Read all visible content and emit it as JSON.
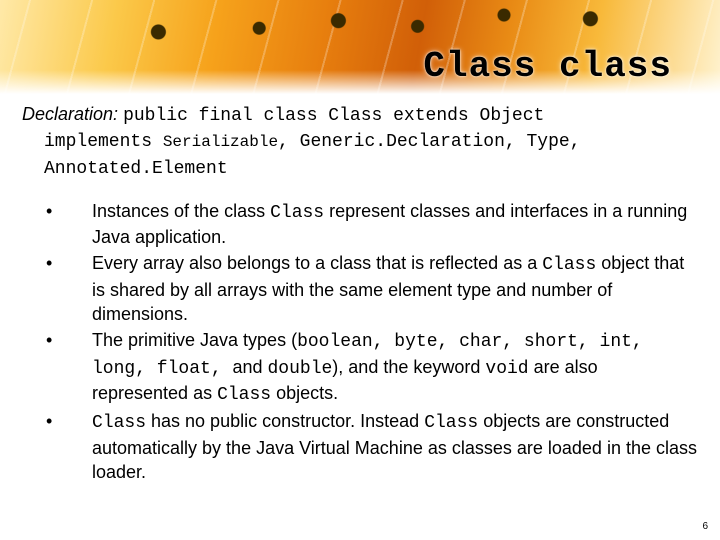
{
  "title": "Class class",
  "declaration": {
    "label": "Declaration:",
    "line1": "public final class Class extends Object",
    "line2a": "implements ",
    "line2b": "Serializable",
    "line2c": ", Generic.Declaration, Type, Annotated.Element"
  },
  "bullets": {
    "b1": {
      "pre": "Instances of the class ",
      "code": "Class",
      "post": " represent classes and interfaces in a running Java application."
    },
    "b2": {
      "pre": "Every array also belongs to a class that is reflected as a ",
      "code": "Class",
      "post": " object that is shared by all arrays with the same element type and number of dimensions."
    },
    "b3": {
      "pre": "The primitive Java types (",
      "code1": "boolean, byte, char, short, int, long, float, ",
      "mid1": "and ",
      "code2": "double",
      "mid2": "), and the keyword ",
      "code3": "void",
      "mid3": " are also represented as ",
      "code4": "Class",
      "post": " objects."
    },
    "b4": {
      "code1": "Class",
      "mid1": " has no public constructor. Instead ",
      "code2": "Class",
      "post": " objects are constructed automatically by the Java Virtual Machine as classes are loaded in the class loader."
    }
  },
  "page_number": "6"
}
